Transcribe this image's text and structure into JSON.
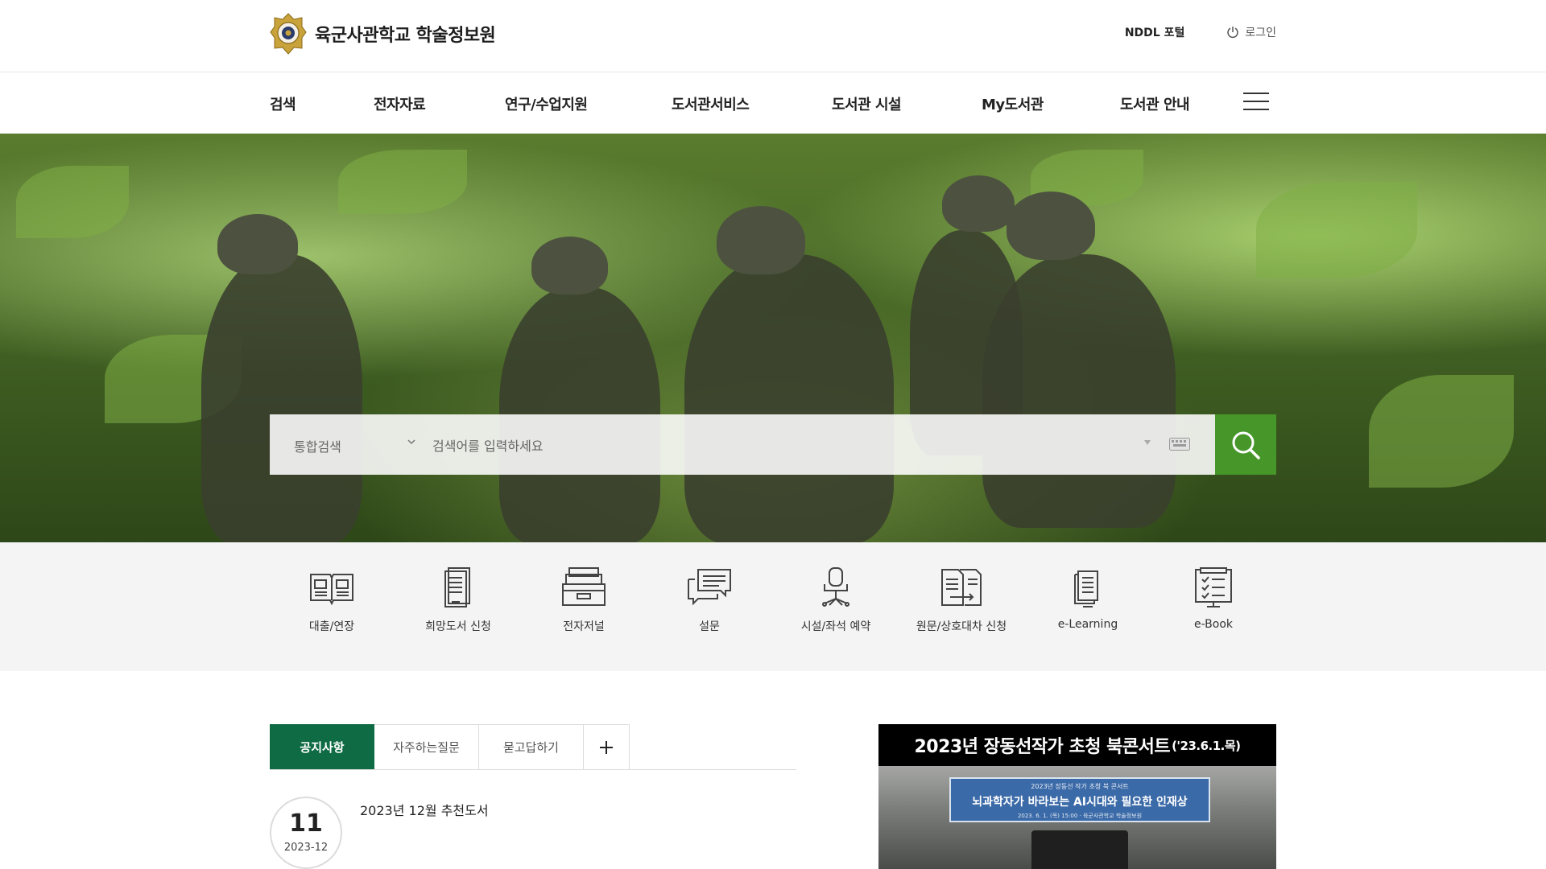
{
  "header": {
    "logo_text": "육군사관학교 학술정보원",
    "nddl_label": "NDDL 포털",
    "login_label": "로그인"
  },
  "gnb": {
    "items": [
      "검색",
      "전자자료",
      "연구/수업지원",
      "도서관서비스",
      "도서관 시설",
      "My도서관",
      "도서관 안내"
    ],
    "menu_icon": "hamburger-icon"
  },
  "search": {
    "category": "통합검색",
    "placeholder": "검색어를 입력하세요",
    "button_icon": "search-icon",
    "accent": "#46962a"
  },
  "quick_menu": [
    {
      "label": "대출/연장",
      "icon": "book-open-icon"
    },
    {
      "label": "희망도서 신청",
      "icon": "book-request-icon"
    },
    {
      "label": "전자저널",
      "icon": "archive-box-icon"
    },
    {
      "label": "설문",
      "icon": "chat-bubble-icon"
    },
    {
      "label": "시설/좌석 예약",
      "icon": "chair-icon"
    },
    {
      "label": "원문/상호대차 신청",
      "icon": "document-exchange-icon"
    },
    {
      "label": "e-Learning",
      "icon": "elearning-icon"
    },
    {
      "label": "e-Book",
      "icon": "ebook-icon"
    }
  ],
  "board": {
    "tabs": [
      "공지사항",
      "자주하는질문",
      "묻고답하기"
    ],
    "more_label": "+",
    "active_color": "#0e6b43",
    "notice": {
      "day": "11",
      "year_month": "2023-12",
      "title": "2023년 12월 추천도서"
    }
  },
  "banner": {
    "title": "2023년 장동선작가 초청 북콘서트",
    "title_date": "('23.6.1.목)",
    "sign_line1": "2023년 장동선 작가 초청 북 콘서트",
    "sign_line2": "뇌과학자가 바라보는 AI시대와 필요한 인재상",
    "sign_line3": "2023. 6. 1. (목) 15:00 · 육군사관학교 학술정보원"
  }
}
